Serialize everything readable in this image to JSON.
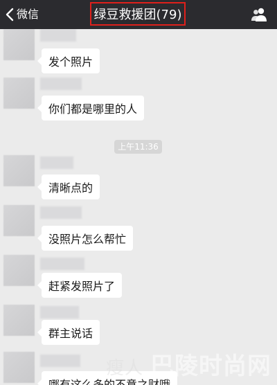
{
  "nav": {
    "back_label": "微信",
    "title": "绿豆救援团(79)",
    "accent": "#e0201b"
  },
  "messages": [
    {
      "text": "发个照片"
    },
    {
      "text": "你们都是哪里的人"
    },
    {
      "text": "清晰点的"
    },
    {
      "text": "没照片怎么帮忙"
    },
    {
      "text": "赶紧发照片了"
    },
    {
      "text": "群主说话"
    },
    {
      "text": "哪有这么多的不意之财哦"
    }
  ],
  "timestamp": "上午11:36",
  "watermark": {
    "dim": "瘦人",
    "main": "巴陵时尚网"
  }
}
